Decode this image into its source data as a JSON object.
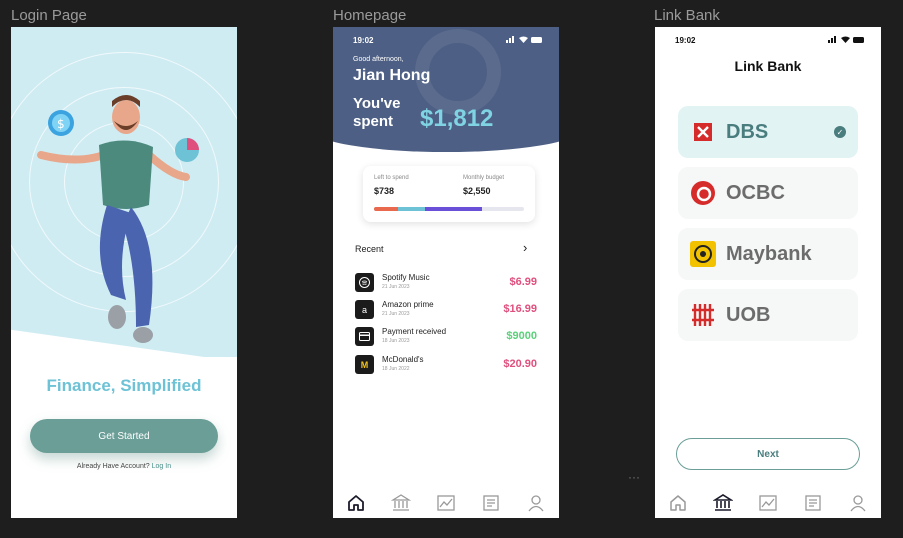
{
  "frames": {
    "login_label": "Login Page",
    "home_label": "Homepage",
    "bank_label": "Link Bank"
  },
  "login": {
    "title": "Finance, Simplified",
    "get_started": "Get Started",
    "already_text": "Already Have Account?",
    "login_link": "Log In"
  },
  "home": {
    "time": "19:02",
    "greeting": "Good afternoon,",
    "name": "Jian Hong",
    "spent_label": "You've spent",
    "spent_value": "$1,812",
    "left_label": "Left to spend",
    "left_value": "$738",
    "budget_label": "Monthly budget",
    "budget_value": "$2,550",
    "recent_label": "Recent",
    "transactions": [
      {
        "name": "Spotify Music",
        "date": "21 Jun 2023",
        "amount": "$6.99",
        "color": "#e0507e",
        "icon": "spotify-icon"
      },
      {
        "name": "Amazon prime",
        "date": "21 Jun 2023",
        "amount": "$16.99",
        "color": "#e0507e",
        "icon": "amazon-icon"
      },
      {
        "name": "Payment received",
        "date": "18 Jun 2023",
        "amount": "$9000",
        "color": "#5bd07a",
        "icon": "card-icon"
      },
      {
        "name": "McDonald's",
        "date": "18 Jun 2022",
        "amount": "$20.90",
        "color": "#e0507e",
        "icon": "mcdonalds-icon"
      }
    ]
  },
  "bank": {
    "time": "19:02",
    "title": "Link Bank",
    "banks": [
      "DBS",
      "OCBC",
      "Maybank",
      "UOB"
    ],
    "next": "Next"
  },
  "colors": {
    "accent": "#6a9e97",
    "header": "#4d5f84",
    "highlight": "#7fd3e3"
  }
}
